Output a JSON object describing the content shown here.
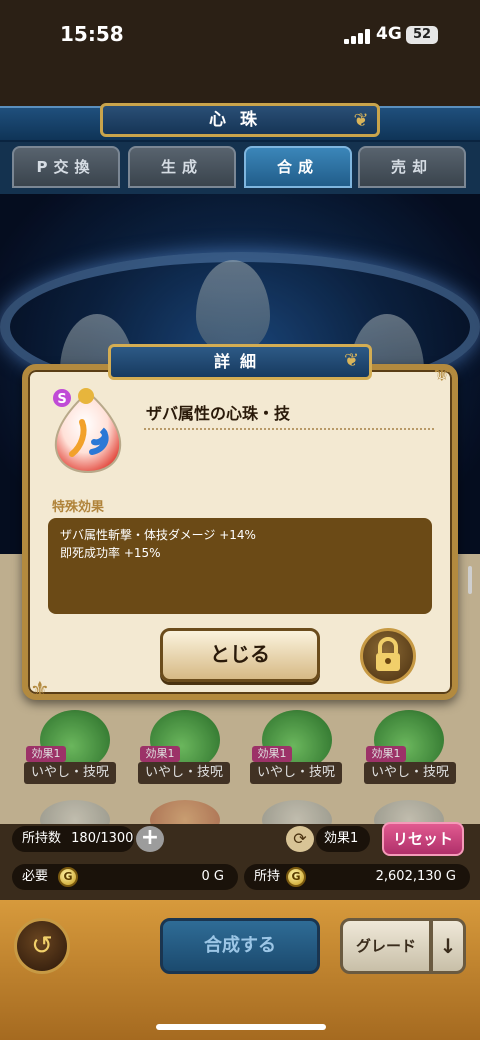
{
  "status": {
    "time": "15:58",
    "network": "4G",
    "battery": "52"
  },
  "header": {
    "title": "心珠"
  },
  "tabs": [
    {
      "label": "P交換"
    },
    {
      "label": "生成"
    },
    {
      "label": "合成",
      "active": true
    },
    {
      "label": "売却"
    }
  ],
  "cards": [
    {
      "tag": "効果1",
      "label": "いやし・技呪"
    },
    {
      "tag": "効果1",
      "label": "いやし・技呪"
    },
    {
      "tag": "効果1",
      "label": "いやし・技呪"
    },
    {
      "tag": "効果1",
      "label": "いやし・技呪"
    }
  ],
  "dialog": {
    "title": "詳細",
    "item_name": "ザバ属性の心珠・技",
    "grade_badge": "S",
    "section_label": "特殊効果",
    "effects": [
      "ザバ属性斬撃・体技ダメージ +14%",
      "即死成功率 +15%"
    ],
    "close_label": "とじる"
  },
  "inventory": {
    "count_label": "所持数",
    "count_value": "180/1300",
    "effect_filter": "効果1",
    "reset_label": "リセット",
    "required_label": "必要",
    "required_value": "0 G",
    "owned_label": "所持",
    "owned_value": "2,602,130 G",
    "coin_glyph": "G"
  },
  "footer": {
    "synth_label": "合成する",
    "grade_label": "グレード",
    "sort_glyph": "↓"
  },
  "colors": {
    "header_blue": "#1f4f7c",
    "gold_frame": "#b38a3e",
    "effect_box": "#6b4a16",
    "reset_pink": "#c8407a"
  }
}
